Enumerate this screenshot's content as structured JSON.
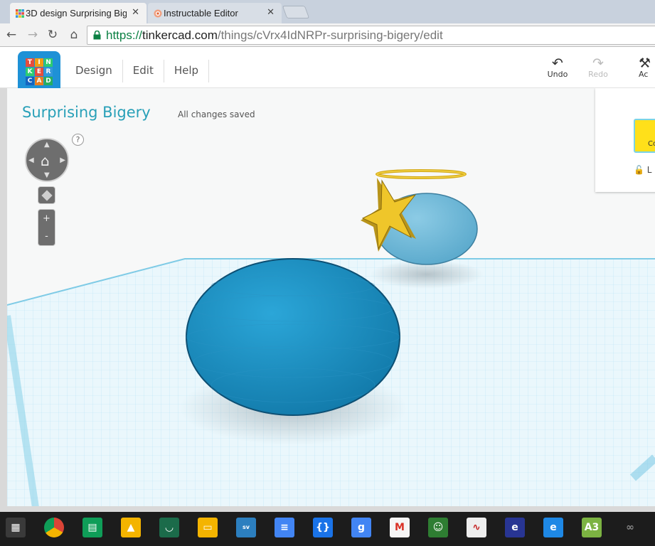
{
  "browser": {
    "tabs": [
      {
        "title": "3D design Surprising Big",
        "active": true
      },
      {
        "title": "Instructable Editor",
        "active": false
      }
    ],
    "url": {
      "scheme": "https://",
      "host": "tinkercad.com",
      "path": "/things/cVrx4IdNRPr-surprising-bigery/edit"
    },
    "tab_close": "✕"
  },
  "app": {
    "logo_letters": [
      "T",
      "I",
      "N",
      "K",
      "E",
      "R",
      "C",
      "A",
      "D"
    ],
    "menu": [
      "Design",
      "Edit",
      "Help"
    ],
    "actions": {
      "undo": "Undo",
      "redo": "Redo",
      "add_partial": "Ac"
    },
    "design_title": "Surprising Bigery",
    "save_status": "All changes saved",
    "help_glyph": "?",
    "zoom_in": "+",
    "zoom_out": "-",
    "inspector": {
      "swatch_label": "Co",
      "lock_label": "L"
    }
  },
  "colors": {
    "shape_blue": "#1e90c4",
    "shape_light_blue": "#7fc0de",
    "star_yellow": "#e8c31f",
    "grid_line": "#9fd8ec",
    "title_teal": "#28a0b8"
  },
  "taskbar": {
    "icons": [
      "apps-launcher-icon",
      "chrome-icon",
      "sheets-icon",
      "drive-icon",
      "geogebra-icon",
      "slides-icon",
      "sparkvue-icon",
      "docs-icon",
      "code-icon",
      "google-search-icon",
      "gmail-icon",
      "classroom-icon",
      "graph-icon",
      "math-e-icon",
      "e-icon",
      "a3-icon",
      "more-icon"
    ]
  }
}
